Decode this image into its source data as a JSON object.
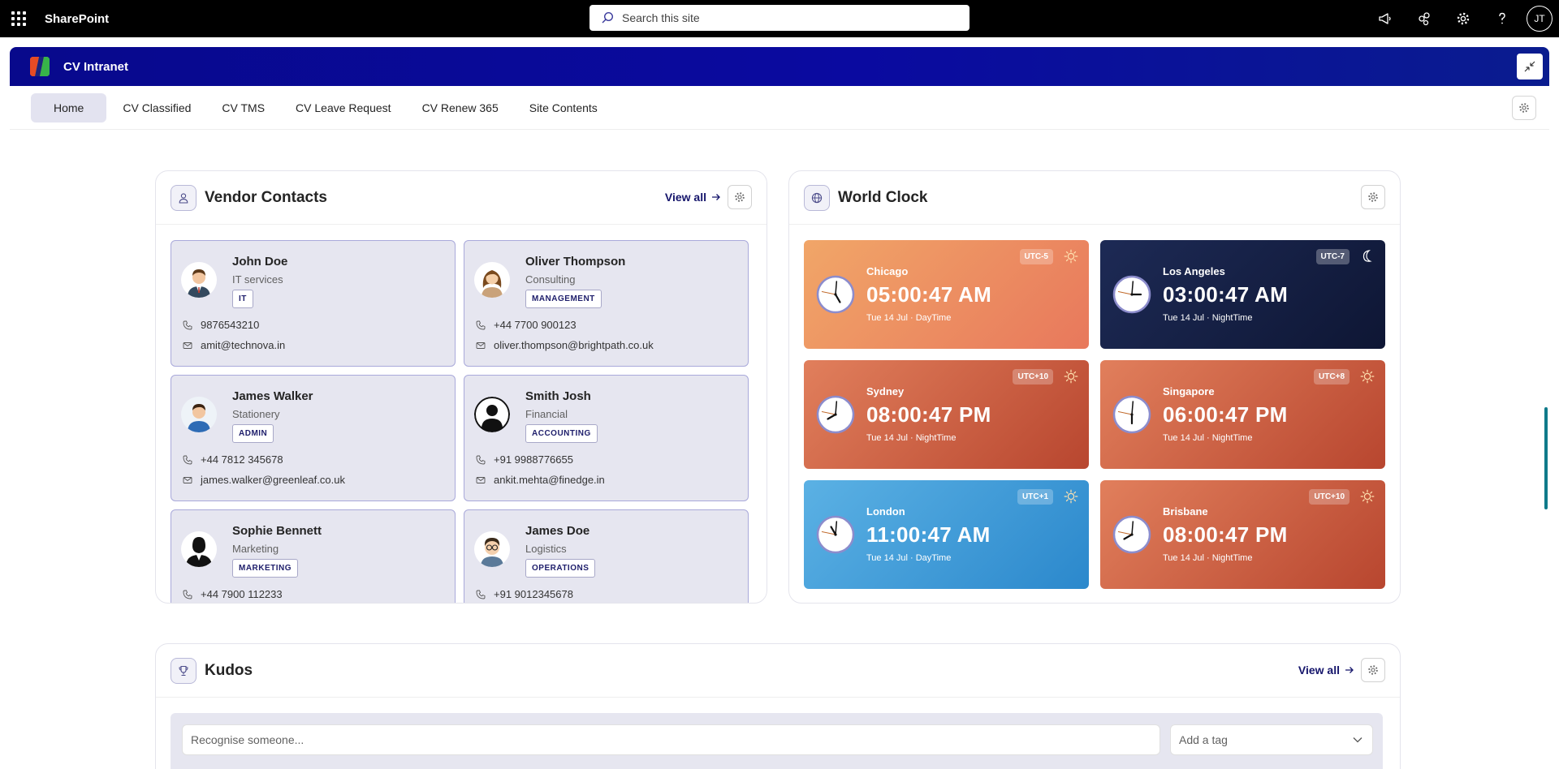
{
  "suite": {
    "title": "SharePoint",
    "search_placeholder": "Search this site",
    "user_initials": "JT"
  },
  "site": {
    "title": "CV Intranet"
  },
  "nav": {
    "items": [
      {
        "label": "Home",
        "active": true
      },
      {
        "label": "CV Classified"
      },
      {
        "label": "CV TMS"
      },
      {
        "label": "CV Leave Request"
      },
      {
        "label": "CV Renew 365"
      },
      {
        "label": "Site Contents"
      }
    ]
  },
  "vendor": {
    "title": "Vendor Contacts",
    "view_all": "View all",
    "contacts": [
      {
        "name": "John Doe",
        "dept": "IT services",
        "tag": "IT",
        "phone": "9876543210",
        "email": "amit@technova.in",
        "avatar": "man-suit-icon"
      },
      {
        "name": "Oliver Thompson",
        "dept": "Consulting",
        "tag": "MANAGEMENT",
        "phone": "+44 7700 900123",
        "email": "oliver.thompson@brightpath.co.uk",
        "avatar": "woman-icon"
      },
      {
        "name": "James Walker",
        "dept": "Stationery",
        "tag": "ADMIN",
        "phone": "+44 7812 345678",
        "email": "james.walker@greenleaf.co.uk",
        "avatar": "man-blue-icon"
      },
      {
        "name": "Smith Josh",
        "dept": "Financial",
        "tag": "ACCOUNTING",
        "phone": "+91 9988776655",
        "email": "ankit.mehta@finedge.in",
        "avatar": "silhouette-icon"
      },
      {
        "name": "Sophie Bennett",
        "dept": "Marketing",
        "tag": "MARKETING",
        "phone": "+44 7900 112233",
        "email": "",
        "avatar": "silhouette-suit-icon"
      },
      {
        "name": "James Doe",
        "dept": "Logistics",
        "tag": "OPERATIONS",
        "phone": "+91 9012345678",
        "email": "",
        "avatar": "man-glasses-icon"
      }
    ]
  },
  "clock": {
    "title": "World Clock",
    "cities": [
      {
        "city": "Chicago",
        "time": "05:00:47 AM",
        "date": "Tue 14 Jul · DayTime",
        "utc": "UTC-5",
        "period": "day",
        "theme": "day-orange",
        "hour": 5,
        "minute": 0,
        "second": 47
      },
      {
        "city": "Los Angeles",
        "time": "03:00:47 AM",
        "date": "Tue 14 Jul · NightTime",
        "utc": "UTC-7",
        "period": "night",
        "theme": "night-navy",
        "hour": 3,
        "minute": 0,
        "second": 47
      },
      {
        "city": "Sydney",
        "time": "08:00:47 PM",
        "date": "Tue 14 Jul · NightTime",
        "utc": "UTC+10",
        "period": "day",
        "theme": "night-red",
        "hour": 8,
        "minute": 0,
        "second": 47
      },
      {
        "city": "Singapore",
        "time": "06:00:47 PM",
        "date": "Tue 14 Jul · NightTime",
        "utc": "UTC+8",
        "period": "day",
        "theme": "night-red",
        "hour": 6,
        "minute": 0,
        "second": 47
      },
      {
        "city": "London",
        "time": "11:00:47 AM",
        "date": "Tue 14 Jul · DayTime",
        "utc": "UTC+1",
        "period": "day",
        "theme": "day-blue",
        "hour": 11,
        "minute": 0,
        "second": 47
      },
      {
        "city": "Brisbane",
        "time": "08:00:47 PM",
        "date": "Tue 14 Jul · NightTime",
        "utc": "UTC+10",
        "period": "day",
        "theme": "night-red",
        "hour": 8,
        "minute": 0,
        "second": 47
      }
    ]
  },
  "kudos": {
    "title": "Kudos",
    "view_all": "View all",
    "input_placeholder": "Recognise someone...",
    "tag_placeholder": "Add a tag"
  },
  "colors": {
    "header_gradient_start": "#08098c",
    "accent": "#15156b",
    "vendor_card_bg": "#e6e6f0"
  }
}
